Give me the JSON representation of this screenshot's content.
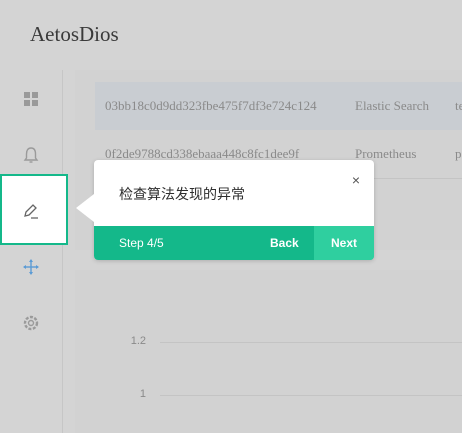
{
  "app": {
    "title": "AetosDios"
  },
  "sidebar": {
    "items": [
      {
        "icon": "dashboard-icon"
      },
      {
        "icon": "bell-icon"
      },
      {
        "icon": "pencil-icon"
      },
      {
        "icon": "move-icon"
      },
      {
        "icon": "settings-icon"
      }
    ]
  },
  "table": {
    "rows": [
      {
        "id": "03bb18c0d9dd323fbe475f7df3e724c124",
        "source": "Elastic Search",
        "extra": "te"
      },
      {
        "id": "0f2de9788cd338ebaaa448c8fc1dee9f",
        "source": "Prometheus",
        "extra": "p"
      }
    ]
  },
  "chart": {
    "y_ticks": [
      "1.2",
      "1"
    ]
  },
  "tour": {
    "text": "检查算法发现的异常",
    "close": "×",
    "step": "Step 4/5",
    "back": "Back",
    "next": "Next"
  },
  "colors": {
    "accent": "#14b88a",
    "accent_light": "#2fcf9f"
  }
}
